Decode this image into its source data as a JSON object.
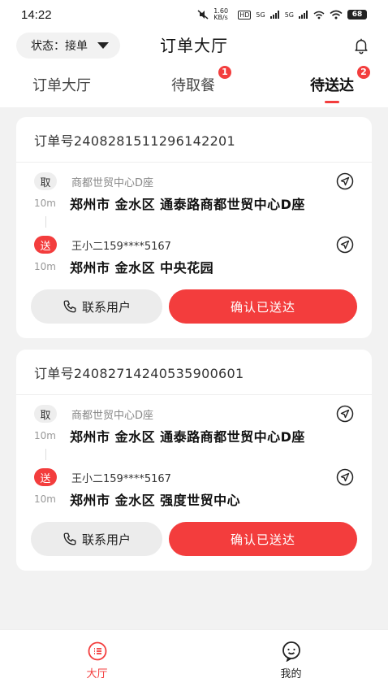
{
  "status_bar": {
    "time": "14:22",
    "net_speed": "1.60 KB/s",
    "hd": "HD",
    "signal1": "5G",
    "signal2": "5G",
    "battery": "68"
  },
  "header": {
    "status_label": "状态：接单",
    "title": "订单大厅"
  },
  "tabs": [
    {
      "label": "订单大厅",
      "badge": ""
    },
    {
      "label": "待取餐",
      "badge": "1"
    },
    {
      "label": "待送达",
      "badge": "2"
    }
  ],
  "orders": [
    {
      "order_no": "订单号2408281511296142201",
      "pickup": {
        "tag": "取",
        "name": "商都世贸中心D座",
        "distance": "10m",
        "address": "郑州市 金水区 通泰路商都世贸中心D座"
      },
      "dropoff": {
        "tag": "送",
        "name": "王小二159****5167",
        "distance": "10m",
        "address": "郑州市 金水区 中央花园"
      },
      "contact_label": "联系用户",
      "confirm_label": "确认已送达"
    },
    {
      "order_no": "订单号2408271424053590060​1",
      "pickup": {
        "tag": "取",
        "name": "商都世贸中心D座",
        "distance": "10m",
        "address": "郑州市 金水区 通泰路商都世贸中心D座"
      },
      "dropoff": {
        "tag": "送",
        "name": "王小二159****5167",
        "distance": "10m",
        "address": "郑州市 金水区 强度世贸中心"
      },
      "contact_label": "联系用户",
      "confirm_label": "确认已送达"
    }
  ],
  "bottom_nav": [
    {
      "label": "大厅",
      "icon": "hall-icon"
    },
    {
      "label": "我的",
      "icon": "profile-icon"
    }
  ],
  "colors": {
    "accent": "#f33d3d"
  }
}
